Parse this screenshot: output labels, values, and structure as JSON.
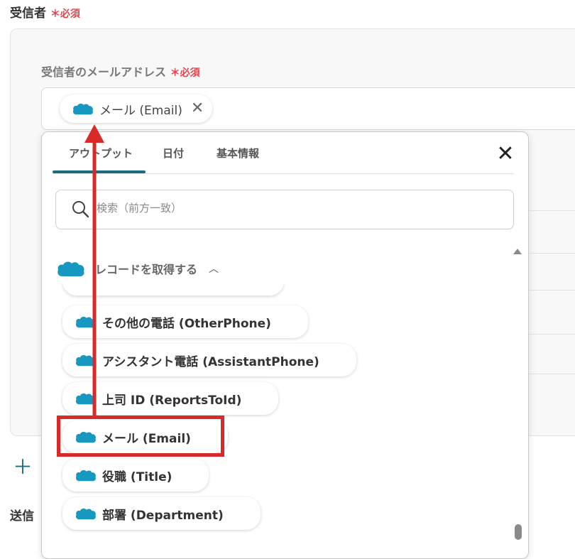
{
  "recipients": {
    "label": "受信者",
    "required_mark": "＊",
    "required_text": "必須"
  },
  "email_field": {
    "label": "受信者のメールアドレス",
    "required_mark": "＊",
    "required_text": "必須",
    "chip_label": "メール (Email)"
  },
  "popup": {
    "tabs": [
      {
        "label": "アウトプット",
        "active": true
      },
      {
        "label": "日付",
        "active": false
      },
      {
        "label": "基本情報",
        "active": false
      }
    ],
    "search_placeholder": "検索（前方一致）",
    "group_title": "レコードを取得する",
    "items": [
      {
        "label": "その他の電話 (OtherPhone)"
      },
      {
        "label": "アシスタント電話 (AssistantPhone)"
      },
      {
        "label": "上司 ID (ReportsToId)"
      },
      {
        "label": "メール (Email)",
        "highlighted": true
      },
      {
        "label": "役職 (Title)"
      },
      {
        "label": "部署 (Department)"
      }
    ]
  },
  "bottom_section": {
    "label": "送信"
  },
  "colors": {
    "accent": "#1b6d7e",
    "required": "#e0454f",
    "salesforce_blue": "#1798c1",
    "annotation_red": "#d92a2a"
  },
  "icons": {
    "chip": "salesforce-cloud-icon",
    "close": "close-icon",
    "search": "search-icon",
    "collapse": "chevron-up-icon",
    "add": "plus-icon"
  }
}
